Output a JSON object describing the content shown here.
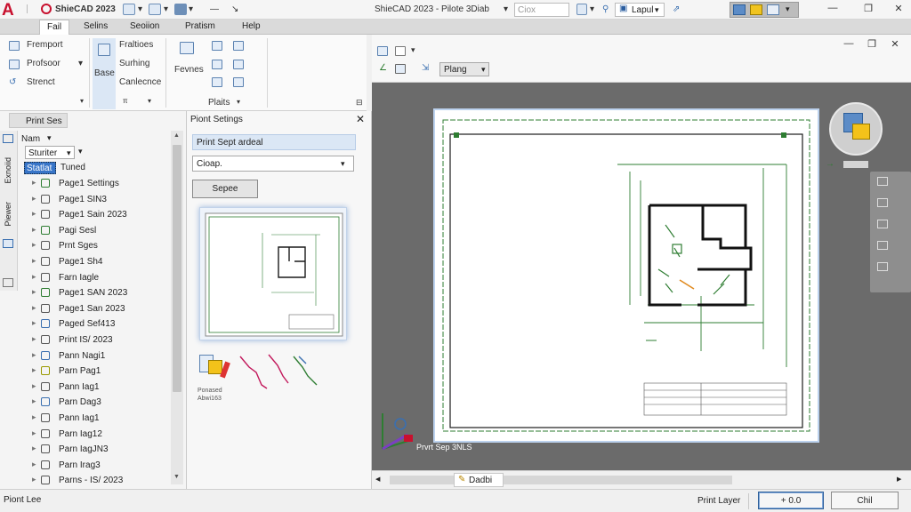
{
  "titlebar": {
    "app_name": "ShieCAD 2023",
    "document_title": "ShieCAD 2023 - Pilote 3Diab",
    "search_placeholder": "Ciox",
    "layout_select": "Lapul",
    "logo_letter": "A"
  },
  "menu": [
    "Fail",
    "Selins",
    "Seoiion",
    "Pratism",
    "Help"
  ],
  "ribbon": {
    "col1": [
      "Fremport",
      "Profsoor",
      "Strenct"
    ],
    "col2_big": "Base",
    "col2": [
      "Fraltioes",
      "Surhing",
      "Canlecnce"
    ],
    "col3_big": "Fevnes",
    "group_label": "Plaits"
  },
  "left_panel": {
    "tab_label": "Print Ses",
    "filter_label": "Nam",
    "dropdown_value": "Sturiter",
    "header_selected": "Statlat",
    "header_next": "Tuned",
    "side_labels": [
      "Piewer",
      "Exnoiid"
    ],
    "tree_items": [
      {
        "label": "Page1 Settings",
        "color": "#2e7d32"
      },
      {
        "label": "Page1 SIN3",
        "color": "#555"
      },
      {
        "label": "Page1 Sain 2023",
        "color": "#555"
      },
      {
        "label": "Pagi Sesl",
        "color": "#2e7d32"
      },
      {
        "label": "Prnt Sges",
        "color": "#555"
      },
      {
        "label": "Page1 Sh4",
        "color": "#555"
      },
      {
        "label": "Farn Iagle",
        "color": "#555"
      },
      {
        "label": "Page1 SAN 2023",
        "color": "#2e7d32"
      },
      {
        "label": "Page1 San 2023",
        "color": "#555"
      },
      {
        "label": "Paged Sef413",
        "color": "#3a6fb0"
      },
      {
        "label": "Print IS/ 2023",
        "color": "#555"
      },
      {
        "label": "Pann Nagi1",
        "color": "#3a6fb0"
      },
      {
        "label": "Parn Pag1",
        "color": "#9a9a00"
      },
      {
        "label": "Pann Iag1",
        "color": "#555"
      },
      {
        "label": "Parn Dag3",
        "color": "#3a6fb0"
      },
      {
        "label": "Pann Iag1",
        "color": "#555"
      },
      {
        "label": "Parn Iag12",
        "color": "#555"
      },
      {
        "label": "Parn IagJN3",
        "color": "#555"
      },
      {
        "label": "Parn Irag3",
        "color": "#555"
      },
      {
        "label": "Parns - IS/ 2023",
        "color": "#555"
      }
    ]
  },
  "print_settings": {
    "title": "Piont Setings",
    "heading": "Print Sept ardeal",
    "dropdown": "Cioap.",
    "button": "Sepee",
    "preview_caption": "Ponased Abwi163"
  },
  "viewport": {
    "view_select": "Plang",
    "coord_label": "Prvrt Sep 3NLS",
    "tab_label": "Dadbi"
  },
  "status": {
    "left_text": "Piont Lee",
    "print_layout_label": "Print Layer",
    "ok_button": "+ 0.0",
    "cancel_button": "Chil"
  }
}
